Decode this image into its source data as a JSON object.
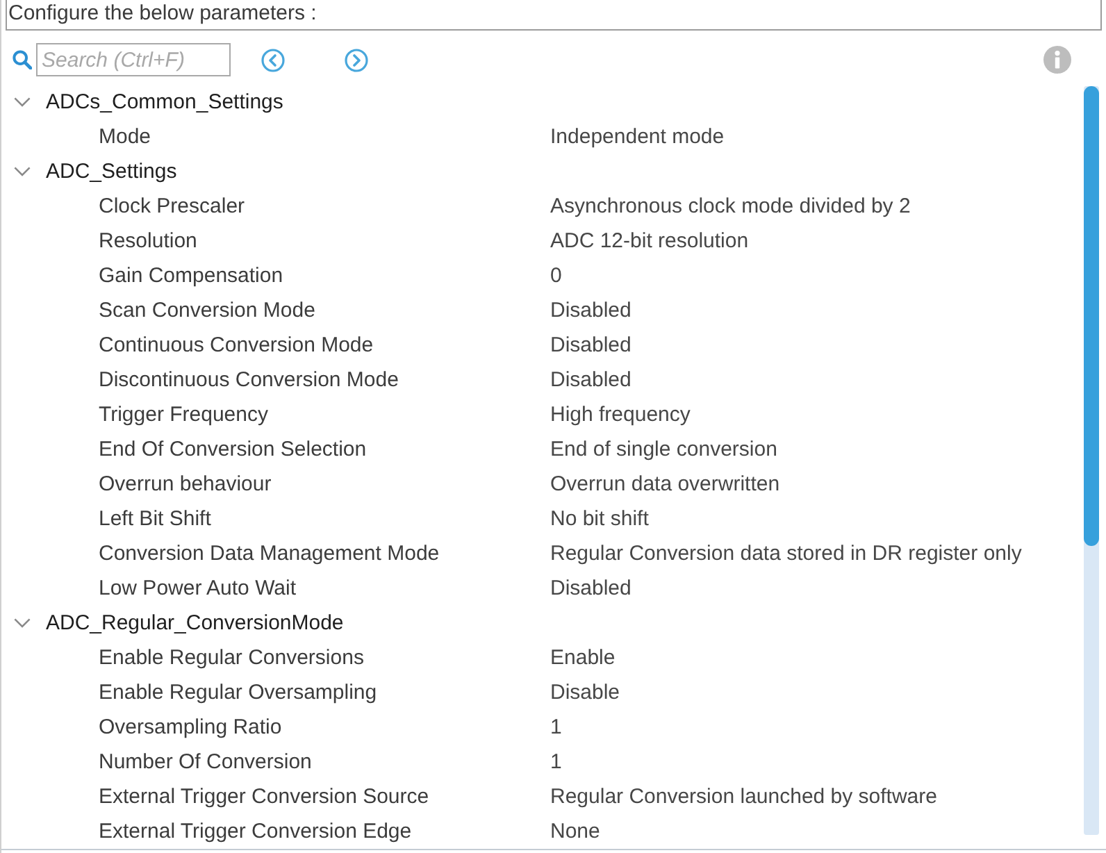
{
  "header": {
    "text": "Configure the below parameters :"
  },
  "toolbar": {
    "search": {
      "placeholder": "Search (Ctrl+F)"
    }
  },
  "tree": [
    {
      "label": "ADCs_Common_Settings",
      "expanded": true,
      "children": [
        {
          "label": "Mode",
          "value": "Independent mode"
        }
      ]
    },
    {
      "label": "ADC_Settings",
      "expanded": true,
      "children": [
        {
          "label": "Clock Prescaler",
          "value": "Asynchronous clock mode divided by 2"
        },
        {
          "label": "Resolution",
          "value": "ADC 12-bit resolution"
        },
        {
          "label": "Gain Compensation",
          "value": "0"
        },
        {
          "label": "Scan Conversion Mode",
          "value": "Disabled"
        },
        {
          "label": "Continuous Conversion Mode",
          "value": "Disabled"
        },
        {
          "label": "Discontinuous Conversion Mode",
          "value": "Disabled"
        },
        {
          "label": "Trigger Frequency",
          "value": "High frequency"
        },
        {
          "label": "End Of Conversion Selection",
          "value": "End of single conversion"
        },
        {
          "label": "Overrun behaviour",
          "value": "Overrun data overwritten"
        },
        {
          "label": "Left Bit Shift",
          "value": "No bit shift"
        },
        {
          "label": "Conversion Data Management Mode",
          "value": "Regular Conversion data stored in DR register only"
        },
        {
          "label": "Low Power Auto Wait",
          "value": "Disabled"
        }
      ]
    },
    {
      "label": "ADC_Regular_ConversionMode",
      "expanded": true,
      "children": [
        {
          "label": "Enable Regular Conversions",
          "value": "Enable"
        },
        {
          "label": "Enable Regular Oversampling",
          "value": "Disable"
        },
        {
          "label": "Oversampling Ratio",
          "value": "1"
        },
        {
          "label": "Number Of Conversion",
          "value": "1"
        },
        {
          "label": "External Trigger Conversion Source",
          "value": "Regular Conversion launched by software"
        },
        {
          "label": "External Trigger Conversion Edge",
          "value": "None"
        }
      ]
    }
  ]
}
